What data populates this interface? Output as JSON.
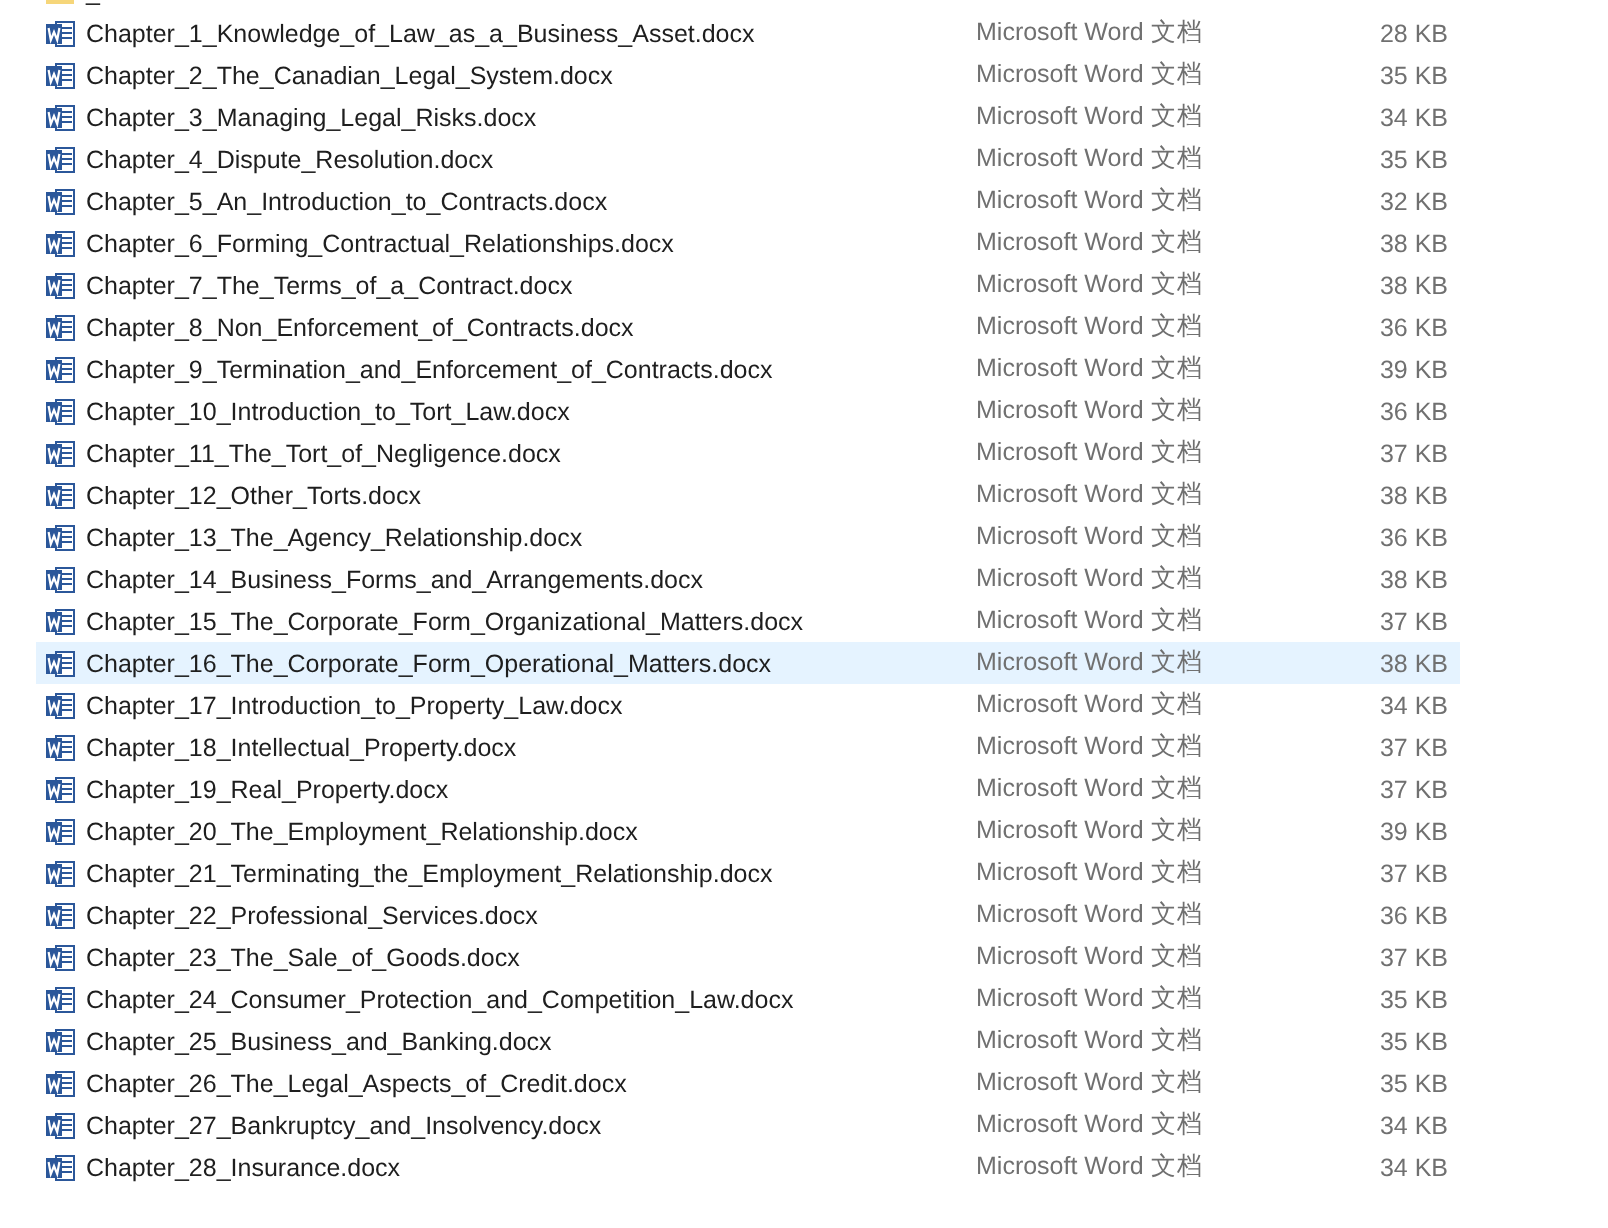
{
  "files": [
    {
      "kind": "folder",
      "name": "_",
      "selected": false
    },
    {
      "kind": "word",
      "name": "Chapter_1_Knowledge_of_Law_as_a_Business_Asset.docx",
      "type": "Microsoft Word 文档",
      "size": "28 KB",
      "selected": false
    },
    {
      "kind": "word",
      "name": "Chapter_2_The_Canadian_Legal_System.docx",
      "type": "Microsoft Word 文档",
      "size": "35 KB",
      "selected": false
    },
    {
      "kind": "word",
      "name": "Chapter_3_Managing_Legal_Risks.docx",
      "type": "Microsoft Word 文档",
      "size": "34 KB",
      "selected": false
    },
    {
      "kind": "word",
      "name": "Chapter_4_Dispute_Resolution.docx",
      "type": "Microsoft Word 文档",
      "size": "35 KB",
      "selected": false
    },
    {
      "kind": "word",
      "name": "Chapter_5_An_Introduction_to_Contracts.docx",
      "type": "Microsoft Word 文档",
      "size": "32 KB",
      "selected": false
    },
    {
      "kind": "word",
      "name": "Chapter_6_Forming_Contractual_Relationships.docx",
      "type": "Microsoft Word 文档",
      "size": "38 KB",
      "selected": false
    },
    {
      "kind": "word",
      "name": "Chapter_7_The_Terms_of_a_Contract.docx",
      "type": "Microsoft Word 文档",
      "size": "38 KB",
      "selected": false
    },
    {
      "kind": "word",
      "name": "Chapter_8_Non_Enforcement_of_Contracts.docx",
      "type": "Microsoft Word 文档",
      "size": "36 KB",
      "selected": false
    },
    {
      "kind": "word",
      "name": "Chapter_9_Termination_and_Enforcement_of_Contracts.docx",
      "type": "Microsoft Word 文档",
      "size": "39 KB",
      "selected": false
    },
    {
      "kind": "word",
      "name": "Chapter_10_Introduction_to_Tort_Law.docx",
      "type": "Microsoft Word 文档",
      "size": "36 KB",
      "selected": false
    },
    {
      "kind": "word",
      "name": "Chapter_11_The_Tort_of_Negligence.docx",
      "type": "Microsoft Word 文档",
      "size": "37 KB",
      "selected": false
    },
    {
      "kind": "word",
      "name": "Chapter_12_Other_Torts.docx",
      "type": "Microsoft Word 文档",
      "size": "38 KB",
      "selected": false
    },
    {
      "kind": "word",
      "name": "Chapter_13_The_Agency_Relationship.docx",
      "type": "Microsoft Word 文档",
      "size": "36 KB",
      "selected": false
    },
    {
      "kind": "word",
      "name": "Chapter_14_Business_Forms_and_Arrangements.docx",
      "type": "Microsoft Word 文档",
      "size": "38 KB",
      "selected": false
    },
    {
      "kind": "word",
      "name": "Chapter_15_The_Corporate_Form_Organizational_Matters.docx",
      "type": "Microsoft Word 文档",
      "size": "37 KB",
      "selected": false
    },
    {
      "kind": "word",
      "name": "Chapter_16_The_Corporate_Form_Operational_Matters.docx",
      "type": "Microsoft Word 文档",
      "size": "38 KB",
      "selected": true
    },
    {
      "kind": "word",
      "name": "Chapter_17_Introduction_to_Property_Law.docx",
      "type": "Microsoft Word 文档",
      "size": "34 KB",
      "selected": false
    },
    {
      "kind": "word",
      "name": "Chapter_18_Intellectual_Property.docx",
      "type": "Microsoft Word 文档",
      "size": "37 KB",
      "selected": false
    },
    {
      "kind": "word",
      "name": "Chapter_19_Real_Property.docx",
      "type": "Microsoft Word 文档",
      "size": "37 KB",
      "selected": false
    },
    {
      "kind": "word",
      "name": "Chapter_20_The_Employment_Relationship.docx",
      "type": "Microsoft Word 文档",
      "size": "39 KB",
      "selected": false
    },
    {
      "kind": "word",
      "name": "Chapter_21_Terminating_the_Employment_Relationship.docx",
      "type": "Microsoft Word 文档",
      "size": "37 KB",
      "selected": false
    },
    {
      "kind": "word",
      "name": "Chapter_22_Professional_Services.docx",
      "type": "Microsoft Word 文档",
      "size": "36 KB",
      "selected": false
    },
    {
      "kind": "word",
      "name": "Chapter_23_The_Sale_of_Goods.docx",
      "type": "Microsoft Word 文档",
      "size": "37 KB",
      "selected": false
    },
    {
      "kind": "word",
      "name": "Chapter_24_Consumer_Protection_and_Competition_Law.docx",
      "type": "Microsoft Word 文档",
      "size": "35 KB",
      "selected": false
    },
    {
      "kind": "word",
      "name": "Chapter_25_Business_and_Banking.docx",
      "type": "Microsoft Word 文档",
      "size": "35 KB",
      "selected": false
    },
    {
      "kind": "word",
      "name": "Chapter_26_The_Legal_Aspects_of_Credit.docx",
      "type": "Microsoft Word 文档",
      "size": "35 KB",
      "selected": false
    },
    {
      "kind": "word",
      "name": "Chapter_27_Bankruptcy_and_Insolvency.docx",
      "type": "Microsoft Word 文档",
      "size": "34 KB",
      "selected": false
    },
    {
      "kind": "word",
      "name": "Chapter_28_Insurance.docx",
      "type": "Microsoft Word 文档",
      "size": "34 KB",
      "selected": false
    }
  ]
}
